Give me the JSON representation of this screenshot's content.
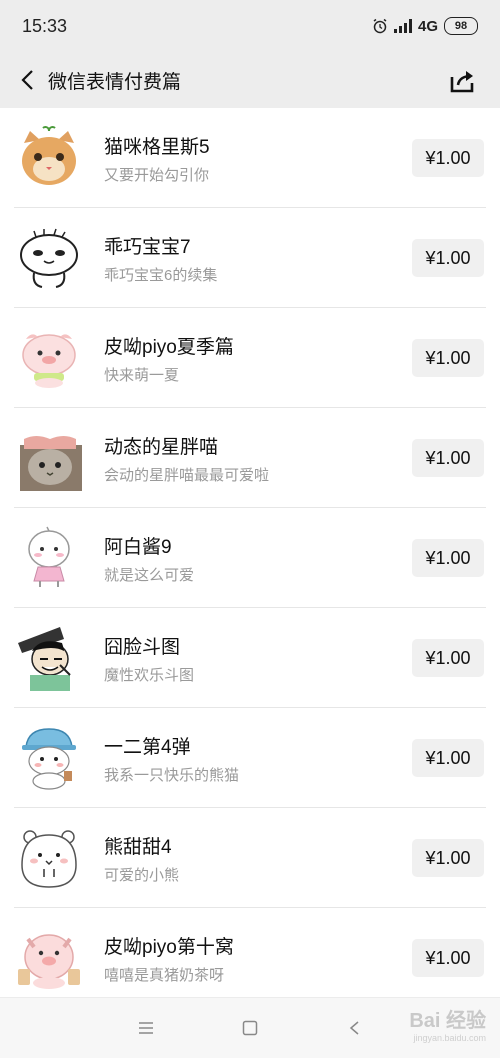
{
  "status_bar": {
    "time": "15:33",
    "network": "4G",
    "battery": "98"
  },
  "nav": {
    "title": "微信表情付费篇"
  },
  "items": [
    {
      "title": "猫咪格里斯5",
      "subtitle": "又要开始勾引你",
      "price": "¥1.00",
      "icon": "orange-cat-sticker"
    },
    {
      "title": "乖巧宝宝7",
      "subtitle": "乖巧宝宝6的续集",
      "price": "¥1.00",
      "icon": "white-doodle-sticker"
    },
    {
      "title": "皮呦piyo夏季篇",
      "subtitle": "快来萌一夏",
      "price": "¥1.00",
      "icon": "pink-pig-sticker"
    },
    {
      "title": "动态的星胖喵",
      "subtitle": "会动的星胖喵最最可爱啦",
      "price": "¥1.00",
      "icon": "gray-cat-sticker"
    },
    {
      "title": "阿白酱9",
      "subtitle": "就是这么可爱",
      "price": "¥1.00",
      "icon": "white-kid-sticker"
    },
    {
      "title": "囧脸斗图",
      "subtitle": "魔性欢乐斗图",
      "price": "¥1.00",
      "icon": "meme-face-sticker"
    },
    {
      "title": "一二第4弹",
      "subtitle": "我系一只快乐的熊猫",
      "price": "¥1.00",
      "icon": "bear-hat-sticker"
    },
    {
      "title": "熊甜甜4",
      "subtitle": "可爱的小熊",
      "price": "¥1.00",
      "icon": "white-bear-sticker"
    },
    {
      "title": "皮呦piyo第十窝",
      "subtitle": "嘻嘻是真猪奶茶呀",
      "price": "¥1.00",
      "icon": "pig-milk-tea-sticker"
    }
  ],
  "watermark": {
    "brand": "Bai 经验",
    "url": "jingyan.baidu.com"
  }
}
